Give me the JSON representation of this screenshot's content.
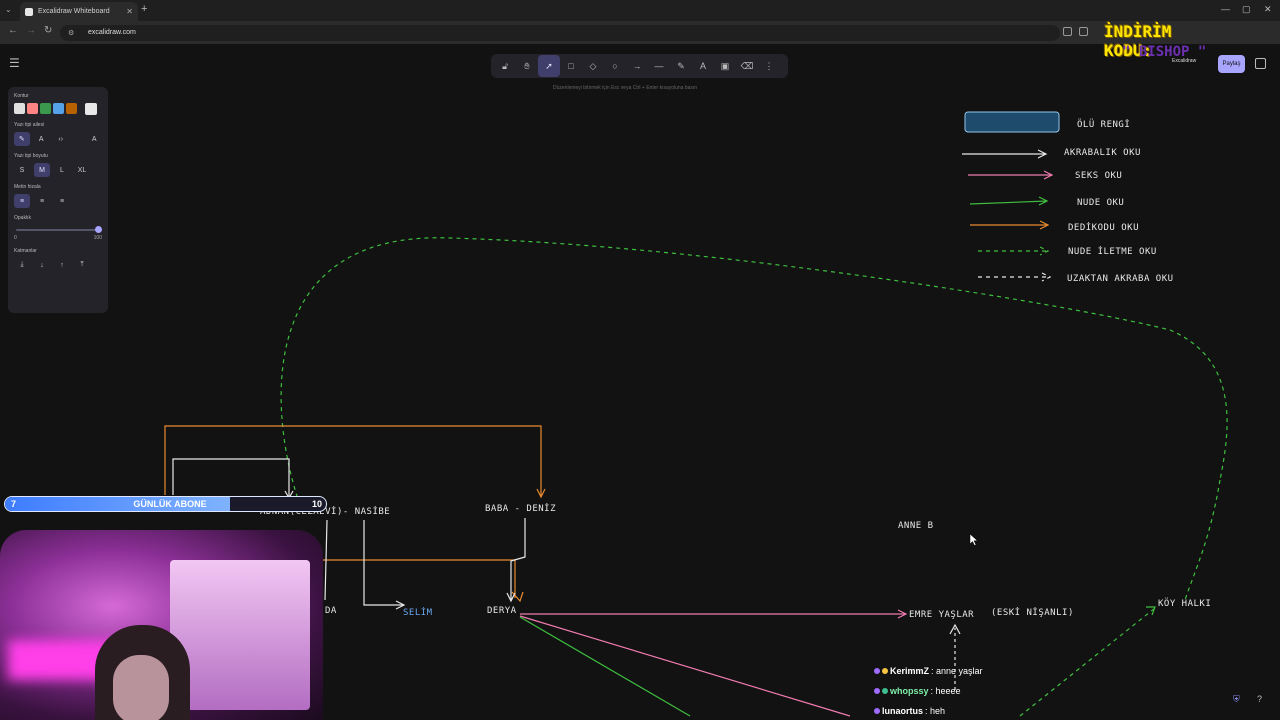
{
  "browser": {
    "tab_title": "Excalidraw Whiteboard",
    "url": "excalidraw.com"
  },
  "excalidraw": {
    "tools": [
      "lock-icon",
      "hand-icon",
      "select-icon",
      "rectangle-icon",
      "diamond-icon",
      "ellipse-icon",
      "arrow-icon",
      "line-icon",
      "pencil-icon",
      "text-icon",
      "image-icon",
      "eraser-icon",
      "more-icon"
    ],
    "active_tool": "select-icon",
    "hint": "Düzenlemeyi bitirmek için Esc veya Ctrl + Enter kısayoluna basın",
    "share_label": "Paylaş",
    "props": {
      "stroke_label": "Kontur",
      "stroke_colors": [
        "#e0e0e0",
        "#ff8383",
        "#3a994c",
        "#56a2e8",
        "#b76100"
      ],
      "stroke_selected": "#e8e8e8",
      "font_family_label": "Yazı tipi ailesi",
      "font_size_label": "Yazı tipi boyutu",
      "font_sizes": [
        "S",
        "M",
        "L",
        "XL"
      ],
      "font_size_selected": "M",
      "align_label": "Metin hizala",
      "opacity_label": "Opaklık",
      "opacity_min": "0",
      "opacity_max": "100",
      "opacity_value": 100,
      "layers_label": "Katmanlar"
    }
  },
  "legend": {
    "dead_color": "#1e4a6b",
    "items": [
      {
        "label": "ÖLÜ RENGİ"
      },
      {
        "label": "AKRABALIK OKU",
        "color": "#e8e8e8"
      },
      {
        "label": "SEKS OKU",
        "color": "#f07bb0"
      },
      {
        "label": "NUDE OKU",
        "color": "#3fbf3f"
      },
      {
        "label": "DEDİKODU OKU",
        "color": "#e88a2f"
      },
      {
        "label": "NUDE İLETME OKU",
        "color": "#3fbf3f"
      },
      {
        "label": "UZAKTAN AKRABA OKU",
        "color": "#e8e8e8"
      }
    ]
  },
  "diagram": {
    "adnan": "ADNAN(CEZAEVİ)- NASİBE",
    "baba": "BABA - DENİZ",
    "selim": "SELİM",
    "derya": "DERYA",
    "emre": "EMRE YAŞLAR",
    "eski": "(ESKİ NİŞANLI)",
    "anne": "ANNE B",
    "koy": "KÖY HALKI",
    "partial_da": "DA"
  },
  "overlay": {
    "promo_line1": "İNDİRİM KODU:",
    "promo_line2": "\" BISHOP \"",
    "promo_side": "Excalidraw",
    "goal_title": "GÜNLÜK ABONE",
    "goal_min": "7",
    "goal_max": "10",
    "goal_progress": 0.7,
    "chat": [
      {
        "user": "KerimmZ",
        "message": ": anne yaşlar",
        "color": "#ffffff"
      },
      {
        "user": "whopssy",
        "message": ": heeee",
        "color": "#7ff0a8"
      },
      {
        "user": "lunaortus",
        "message": ": heh",
        "color": "#ffffff"
      }
    ]
  }
}
